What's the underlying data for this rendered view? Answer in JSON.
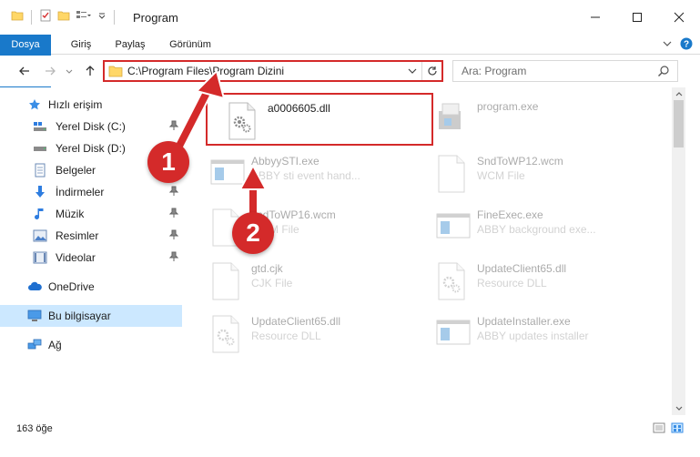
{
  "window": {
    "title": "Program"
  },
  "ribbon": {
    "tabs": [
      "Dosya",
      "Giriş",
      "Paylaş",
      "Görünüm"
    ]
  },
  "address_bar": {
    "path": "C:\\Program Files\\Program Dizini"
  },
  "search": {
    "placeholder": "Ara: Program"
  },
  "sidebar": {
    "items": [
      {
        "label": "Hızlı erişim",
        "icon": "star-icon",
        "pinned": false
      },
      {
        "label": "Yerel Disk (C:)",
        "icon": "drive-icon",
        "pinned": true
      },
      {
        "label": "Yerel Disk (D:)",
        "icon": "drive-icon",
        "pinned": true
      },
      {
        "label": "Belgeler",
        "icon": "documents-icon",
        "pinned": true
      },
      {
        "label": "İndirmeler",
        "icon": "download-icon",
        "pinned": true
      },
      {
        "label": "Müzik",
        "icon": "music-icon",
        "pinned": true
      },
      {
        "label": "Resimler",
        "icon": "pictures-icon",
        "pinned": true
      },
      {
        "label": "Videolar",
        "icon": "videos-icon",
        "pinned": true
      },
      {
        "label": "OneDrive",
        "icon": "cloud-icon",
        "pinned": false
      },
      {
        "label": "Bu bilgisayar",
        "icon": "computer-icon",
        "pinned": false
      },
      {
        "label": "Ağ",
        "icon": "network-icon",
        "pinned": false
      }
    ]
  },
  "files": [
    {
      "name": "a0006605.dll",
      "desc": "",
      "icon": "dll-gear-icon",
      "selected": true
    },
    {
      "name": "AbbyySTI.exe",
      "desc": "ABBY sti event hand...",
      "icon": "exe-window-icon"
    },
    {
      "name": "gtd.cjk",
      "desc": "CJK File",
      "icon": "blank-file-icon"
    },
    {
      "name": "sndToWP16.wcm",
      "desc": "WCM File",
      "icon": "blank-file-icon"
    },
    {
      "name": "UpdateClient65.dll",
      "desc": "Resource DLL",
      "icon": "dll-gear-icon"
    },
    {
      "name": "program.exe",
      "desc": "",
      "icon": "installer-icon"
    },
    {
      "name": "SndToWP12.wcm",
      "desc": "WCM File",
      "icon": "blank-file-icon"
    },
    {
      "name": "FineExec.exe",
      "desc": "ABBY background exe...",
      "icon": "exe-window-icon"
    },
    {
      "name": "UpdateClient65.dll",
      "desc": "Resource DLL",
      "icon": "dll-gear-icon"
    },
    {
      "name": "UpdateInstaller.exe",
      "desc": "ABBY updates installer",
      "icon": "exe-window-icon"
    }
  ],
  "status": {
    "count": "163 öğe"
  },
  "annotations": [
    "1",
    "2"
  ],
  "colors": {
    "accent": "#1979ca",
    "highlight": "#d42a2a",
    "selected_nav": "#cce8ff"
  }
}
